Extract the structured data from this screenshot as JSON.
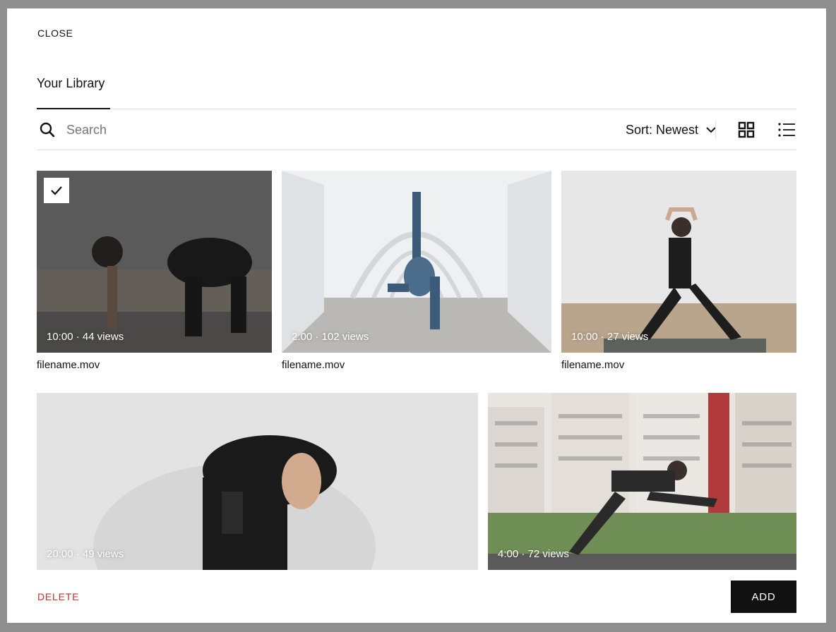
{
  "header": {
    "close_label": "CLOSE"
  },
  "tabs": [
    {
      "label": "Your Library",
      "active": true
    }
  ],
  "toolbar": {
    "search_placeholder": "Search",
    "sort_label": "Sort: Newest",
    "view_modes": [
      "grid-icon",
      "list-icon"
    ],
    "active_view": "grid"
  },
  "items": [
    {
      "meta": "10:00 · 44 views",
      "filename": "filename.mov",
      "selected": true
    },
    {
      "meta": "2:00 · 102 views",
      "filename": "filename.mov",
      "selected": false
    },
    {
      "meta": "10:00 · 27 views",
      "filename": "filename.mov",
      "selected": false
    },
    {
      "meta": "20:00 · 49 views",
      "selected": false
    },
    {
      "meta": "4:00 · 72 views",
      "selected": false
    }
  ],
  "footer": {
    "delete_label": "DELETE",
    "add_label": "ADD"
  },
  "colors": {
    "accent_delete": "#c8312d",
    "primary_button": "#111111",
    "overlay": "#8f8f8f"
  }
}
